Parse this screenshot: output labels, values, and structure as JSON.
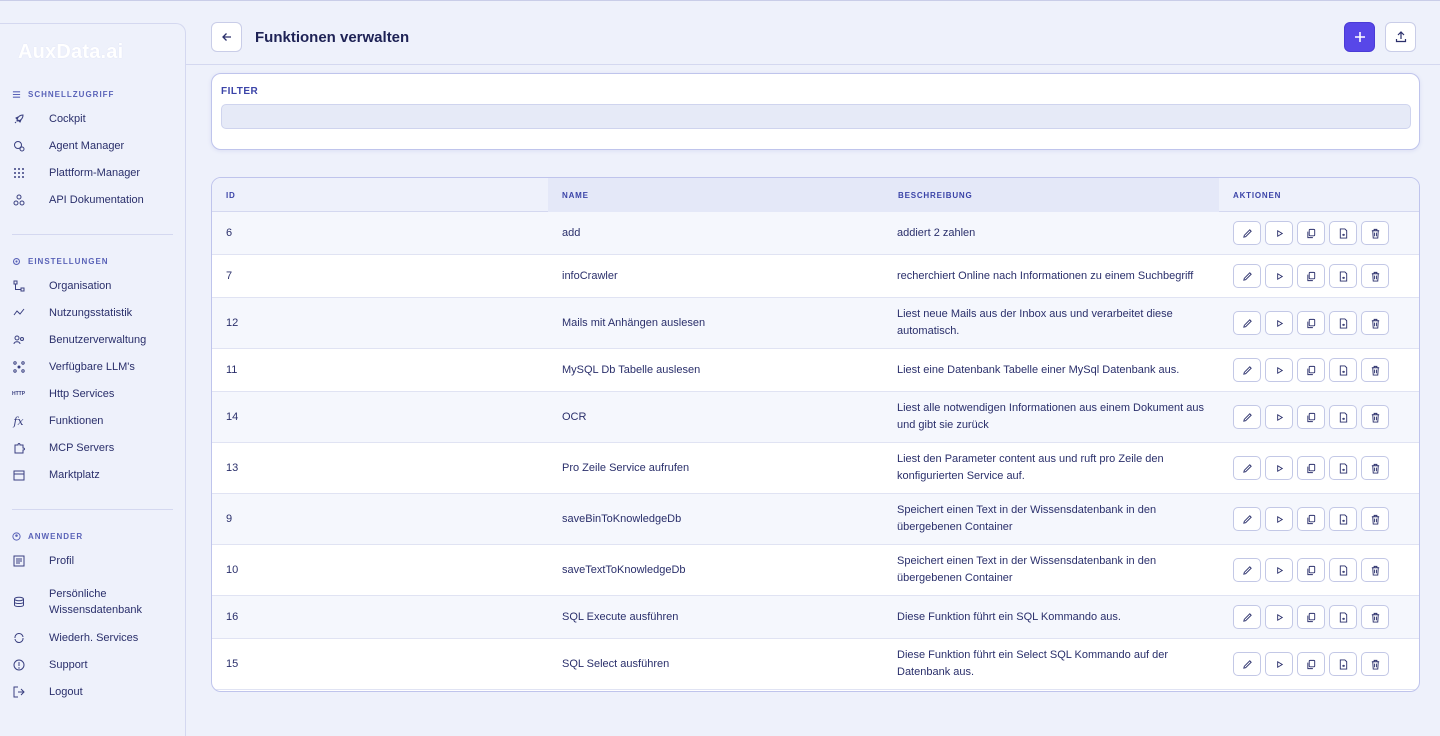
{
  "brand": {
    "logo_text": "AuxData.ai"
  },
  "sidebar": {
    "sections": [
      {
        "title": "SCHNELLZUGRIFF",
        "icon": "menu-icon",
        "items": [
          {
            "label": "Cockpit",
            "icon": "rocket-icon"
          },
          {
            "label": "Agent Manager",
            "icon": "agent-icon"
          },
          {
            "label": "Plattform-Manager",
            "icon": "grid-icon"
          },
          {
            "label": "API Dokumentation",
            "icon": "api-icon"
          }
        ]
      },
      {
        "title": "EINSTELLUNGEN",
        "icon": "gear-icon",
        "items": [
          {
            "label": "Organisation",
            "icon": "org-icon"
          },
          {
            "label": "Nutzungsstatistik",
            "icon": "stats-icon"
          },
          {
            "label": "Benutzerverwaltung",
            "icon": "users-icon"
          },
          {
            "label": "Verfügbare LLM's",
            "icon": "llm-icon"
          },
          {
            "label": "Http Services",
            "icon": "http-icon"
          },
          {
            "label": "Funktionen",
            "icon": "function-icon"
          },
          {
            "label": "MCP Servers",
            "icon": "puzzle-icon"
          },
          {
            "label": "Marktplatz",
            "icon": "store-icon"
          }
        ]
      },
      {
        "title": "ANWENDER",
        "icon": "user-circle-icon",
        "items": [
          {
            "label": "Profil",
            "icon": "profile-icon"
          },
          {
            "label": "Persönliche Wissensdatenbank",
            "icon": "database-icon"
          },
          {
            "label": "Wiederh. Services",
            "icon": "repeat-icon"
          },
          {
            "label": "Support",
            "icon": "support-icon"
          },
          {
            "label": "Logout",
            "icon": "logout-icon"
          }
        ]
      }
    ]
  },
  "header": {
    "title": "Funktionen verwalten"
  },
  "filter": {
    "label": "FILTER",
    "value": "",
    "placeholder": ""
  },
  "table": {
    "columns": [
      "ID",
      "NAME",
      "BESCHREIBUNG",
      "AKTIONEN"
    ],
    "rows": [
      {
        "id": "6",
        "name": "add",
        "description": "addiert 2 zahlen"
      },
      {
        "id": "7",
        "name": "infoCrawler",
        "description": "recherchiert Online nach Informationen zu einem Suchbegriff"
      },
      {
        "id": "12",
        "name": "Mails mit Anhängen auslesen",
        "description": "Liest neue Mails aus der Inbox aus und verarbeitet diese automatisch."
      },
      {
        "id": "11",
        "name": "MySQL Db Tabelle auslesen",
        "description": "Liest eine Datenbank Tabelle einer MySql Datenbank aus."
      },
      {
        "id": "14",
        "name": "OCR",
        "description": "Liest alle notwendigen Informationen aus einem Dokument aus und gibt sie zurück"
      },
      {
        "id": "13",
        "name": "Pro Zeile Service aufrufen",
        "description": "Liest den Parameter content aus und ruft pro Zeile den konfigurierten Service auf."
      },
      {
        "id": "9",
        "name": "saveBinToKnowledgeDb",
        "description": "Speichert einen Text in der Wissensdatenbank in den übergebenen Container"
      },
      {
        "id": "10",
        "name": "saveTextToKnowledgeDb",
        "description": "Speichert einen Text in der Wissensdatenbank in den übergebenen Container"
      },
      {
        "id": "16",
        "name": "SQL Execute ausführen",
        "description": "Diese Funktion führt ein SQL Kommando aus."
      },
      {
        "id": "15",
        "name": "SQL Select ausführen",
        "description": "Diese Funktion führt ein Select SQL Kommando auf der Datenbank aus."
      }
    ],
    "row_actions": [
      "edit-icon",
      "play-icon",
      "copy-icon",
      "export-file-icon",
      "trash-icon"
    ]
  },
  "colors": {
    "accent": "#5847e8",
    "text": "#2a2f6b",
    "header_text": "#3b44a8"
  }
}
